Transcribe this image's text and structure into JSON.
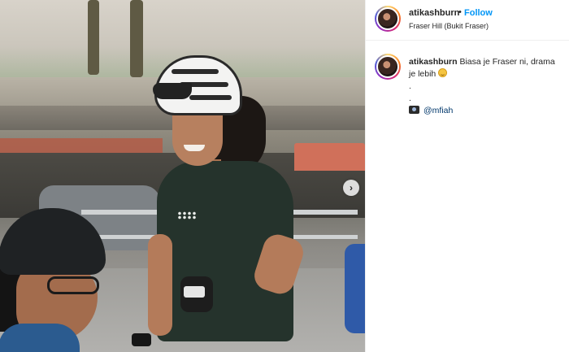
{
  "post": {
    "username": "atikashburn",
    "follow_label": "Follow",
    "separator": "•",
    "location": "Fraser Hill (Bukit Fraser)",
    "caption": {
      "username": "atikashburn",
      "text": "Biasa je Fraser ni, drama je lebih",
      "emoji": "grinning-sweat-emoji",
      "dots": [
        ".",
        "."
      ],
      "camera_icon": "camera-icon",
      "credit_mention": "@mfiah"
    }
  },
  "media": {
    "next_arrow": "›",
    "description_icon": "chevron-right-icon"
  }
}
